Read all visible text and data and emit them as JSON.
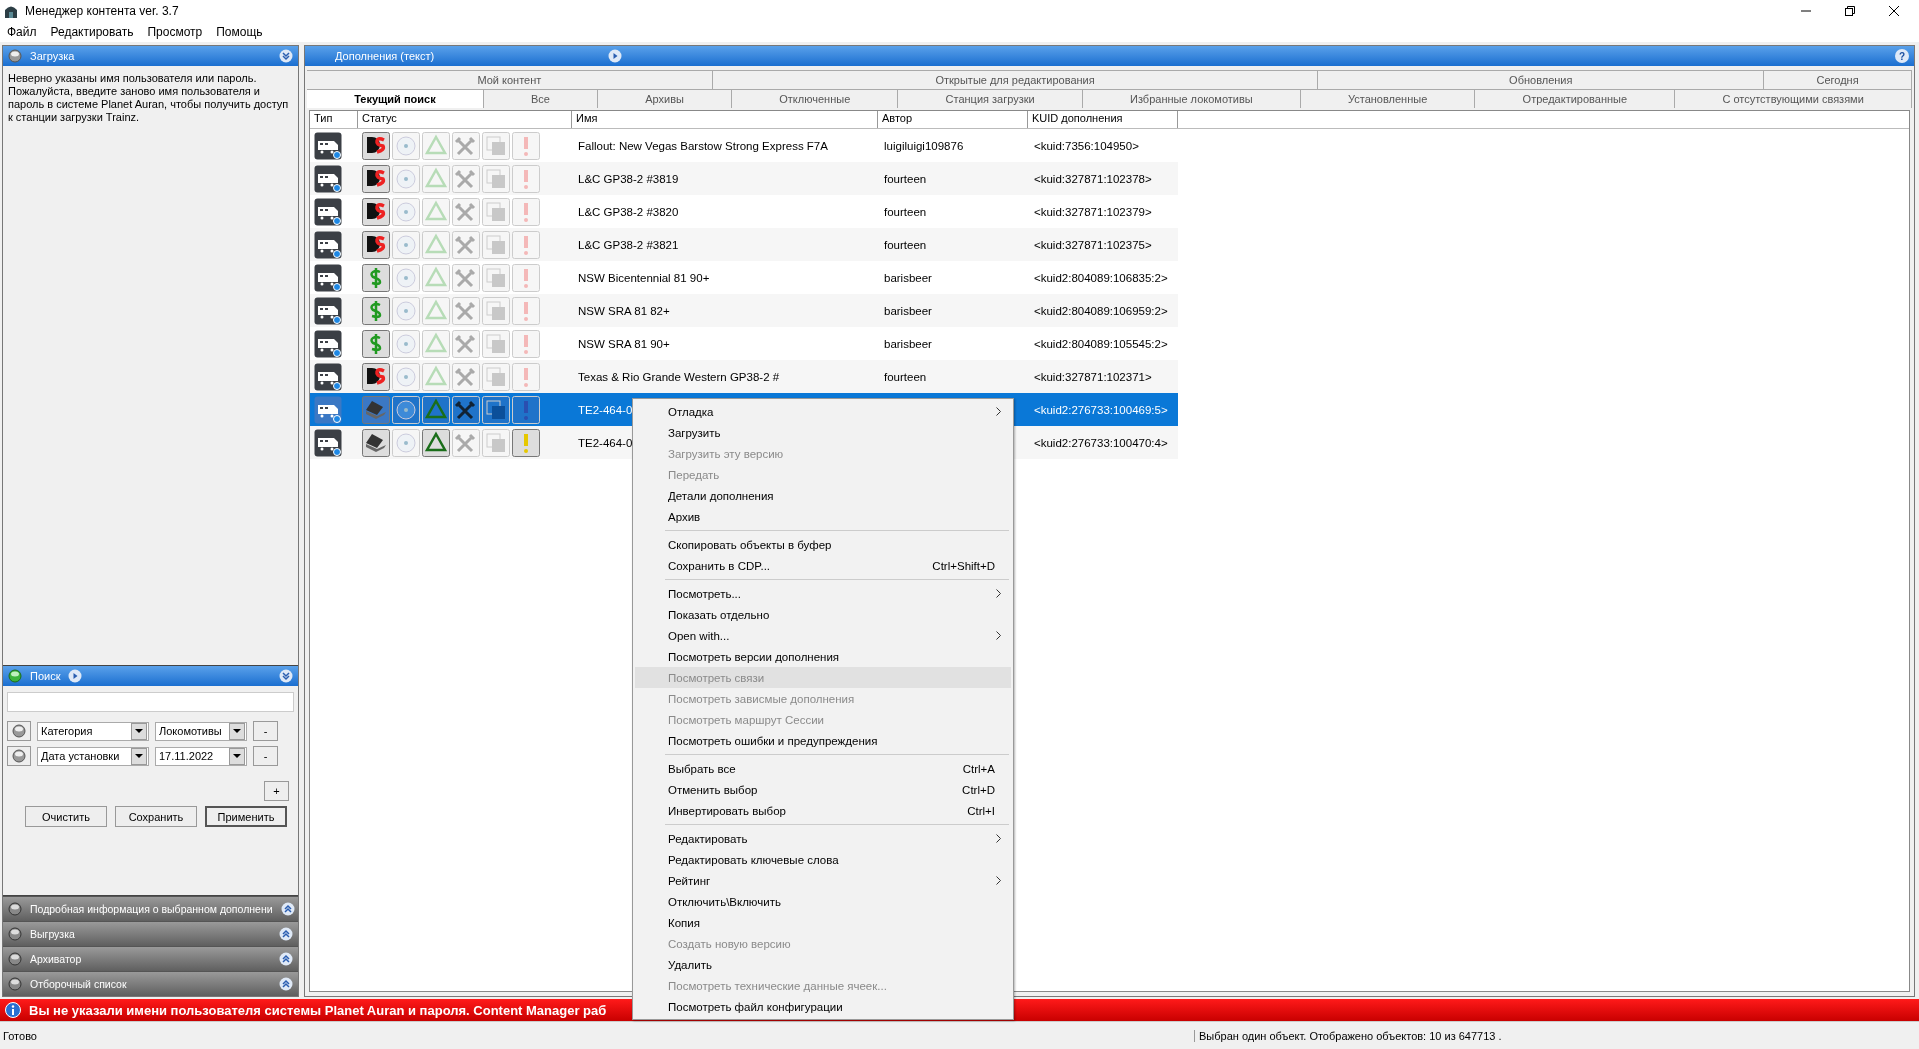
{
  "window": {
    "title": "Менеджер контента ver. 3.7"
  },
  "menu_bar": [
    "Файл",
    "Редактировать",
    "Просмотр",
    "Помощь"
  ],
  "download_panel": {
    "title": "Загрузка",
    "message": "Неверно указаны имя пользователя или пароль. Пожалуйста, введите заново имя пользователя и пароль в системе Planet Auran, чтобы получить доступ к станции загрузки Trainz."
  },
  "search_panel": {
    "title": "Поиск",
    "filters": [
      {
        "field": "Категория",
        "value": "Локомотивы",
        "remove": "-"
      },
      {
        "field": "Дата установки",
        "value": "17.11.2022",
        "remove": "-"
      }
    ],
    "add": "+",
    "buttons": [
      "Очистить",
      "Сохранить",
      "Применить"
    ]
  },
  "collapsed_panels": [
    "Подробная информация о выбранном дополнени",
    "Выгрузка",
    "Архиватор",
    "Отборочный список"
  ],
  "content": {
    "title": "Дополнения (текст)",
    "help": "?",
    "tab_rows": [
      [
        {
          "label": "Мой контент",
          "selected": false
        },
        {
          "label": "Открытые для редактирования",
          "selected": false
        },
        {
          "label": "Обновления",
          "selected": false
        },
        {
          "label": "Сегодня",
          "selected": false
        }
      ],
      [
        {
          "label": "Текущий поиск",
          "selected": true
        },
        {
          "label": "Все",
          "selected": false
        },
        {
          "label": "Архивы",
          "selected": false
        },
        {
          "label": "Отключенные",
          "selected": false
        },
        {
          "label": "Станция загрузки",
          "selected": false
        },
        {
          "label": "Избранные локомотивы",
          "selected": false
        },
        {
          "label": "Установленные",
          "selected": false
        },
        {
          "label": "Отредактированные",
          "selected": false
        },
        {
          "label": "С отсутствующими связями",
          "selected": false
        }
      ]
    ],
    "columns": [
      "Тип",
      "Статус",
      "Имя",
      "Автор",
      "KUID дополнения"
    ],
    "rows": [
      {
        "kind": "ds",
        "name": "Fallout: New Vegas Barstow Strong Express F7A",
        "author": "luigiluigi109876",
        "kuid": "<kuid:7356:104950>",
        "selected": false,
        "warning": false
      },
      {
        "kind": "ds",
        "name": "L&C GP38-2 #3819",
        "author": "fourteen",
        "kuid": "<kuid:327871:102378>",
        "selected": false,
        "warning": false
      },
      {
        "kind": "ds",
        "name": "L&C GP38-2 #3820",
        "author": "fourteen",
        "kuid": "<kuid:327871:102379>",
        "selected": false,
        "warning": false
      },
      {
        "kind": "ds",
        "name": "L&C GP38-2 #3821",
        "author": "fourteen",
        "kuid": "<kuid:327871:102375>",
        "selected": false,
        "warning": false
      },
      {
        "kind": "paid",
        "name": "NSW Bicentennial 81 90+",
        "author": "barisbeer",
        "kuid": "<kuid2:804089:106835:2>",
        "selected": false,
        "warning": false
      },
      {
        "kind": "paid",
        "name": "NSW SRA 81 82+",
        "author": "barisbeer",
        "kuid": "<kuid2:804089:106959:2>",
        "selected": false,
        "warning": false
      },
      {
        "kind": "paid",
        "name": "NSW SRA 81 90+",
        "author": "barisbeer",
        "kuid": "<kuid2:804089:105545:2>",
        "selected": false,
        "warning": false
      },
      {
        "kind": "ds",
        "name": "Texas & Rio Grande Western GP38-2 #",
        "author": "fourteen",
        "kuid": "<kuid:327871:102371>",
        "selected": false,
        "warning": false
      },
      {
        "kind": "local",
        "name": "TE2-464-0",
        "kuid": "<kuid2:276733:100469:5>",
        "selected": true,
        "warning": false
      },
      {
        "kind": "local",
        "name": "TE2-464-0",
        "kuid": "<kuid2:276733:100470:4>",
        "selected": false,
        "warning": true
      }
    ]
  },
  "notice": "Вы не указали имени пользователя системы Planet Auran и пароля. Content Manager раб",
  "status_bar": {
    "left": "Готово",
    "right": "Выбран один объект. Отображено объектов: 10 из 647713 ."
  },
  "context_menu": [
    [
      {
        "label": "Отладка",
        "submenu": true,
        "disabled": false,
        "selected": false
      },
      {
        "label": "Загрузить",
        "submenu": false,
        "disabled": false,
        "selected": false
      },
      {
        "label": "Загрузить эту версию",
        "submenu": false,
        "disabled": true,
        "selected": false
      },
      {
        "label": "Передать",
        "submenu": false,
        "disabled": true,
        "selected": false
      },
      {
        "label": "Детали дополнения",
        "submenu": false,
        "disabled": false,
        "selected": false
      },
      {
        "label": "Архив",
        "submenu": false,
        "disabled": false,
        "selected": false
      }
    ],
    [
      {
        "label": "Скопировать объекты в буфер",
        "submenu": false,
        "disabled": false,
        "selected": false
      },
      {
        "label": "Сохранить в CDP...",
        "shortcut": "Ctrl+Shift+D",
        "submenu": false,
        "disabled": false,
        "selected": false
      }
    ],
    [
      {
        "label": "Посмотреть...",
        "submenu": true,
        "disabled": false,
        "selected": false
      },
      {
        "label": "Показать отдельно",
        "submenu": false,
        "disabled": false,
        "selected": false
      },
      {
        "label": "Open with...",
        "submenu": true,
        "disabled": false,
        "selected": false
      },
      {
        "label": "Посмотреть версии дополнения",
        "submenu": false,
        "disabled": false,
        "selected": false
      },
      {
        "label": "Посмотреть связи",
        "submenu": false,
        "disabled": true,
        "selected": true
      },
      {
        "label": "Посмотреть зависмые дополнения",
        "submenu": false,
        "disabled": true,
        "selected": false
      },
      {
        "label": "Посмотреть маршрут Сессии",
        "submenu": false,
        "disabled": true,
        "selected": false
      },
      {
        "label": "Посмотреть ошибки и предупреждения",
        "submenu": false,
        "disabled": false,
        "selected": false
      }
    ],
    [
      {
        "label": "Выбрать все",
        "shortcut": "Ctrl+A",
        "submenu": false,
        "disabled": false,
        "selected": false
      },
      {
        "label": "Отменить выбор",
        "shortcut": "Ctrl+D",
        "submenu": false,
        "disabled": false,
        "selected": false
      },
      {
        "label": "Инвертировать выбор",
        "shortcut": "Ctrl+I",
        "submenu": false,
        "disabled": false,
        "selected": false
      }
    ],
    [
      {
        "label": "Редактировать",
        "submenu": true,
        "disabled": false,
        "selected": false
      },
      {
        "label": "Редактировать ключевые слова",
        "submenu": false,
        "disabled": false,
        "selected": false
      },
      {
        "label": "Рейтинг",
        "submenu": true,
        "disabled": false,
        "selected": false
      },
      {
        "label": "Отключить\\Включить",
        "submenu": false,
        "disabled": false,
        "selected": false
      },
      {
        "label": "Копия",
        "submenu": false,
        "disabled": false,
        "selected": false
      },
      {
        "label": "Создать новую версию",
        "submenu": false,
        "disabled": true,
        "selected": false
      },
      {
        "label": "Удалить",
        "submenu": false,
        "disabled": false,
        "selected": false
      },
      {
        "label": "Посмотреть технические данные ячеек...",
        "submenu": false,
        "disabled": true,
        "selected": false
      },
      {
        "label": "Посмотреть файл конфигурации",
        "submenu": false,
        "disabled": false,
        "selected": false
      }
    ]
  ]
}
